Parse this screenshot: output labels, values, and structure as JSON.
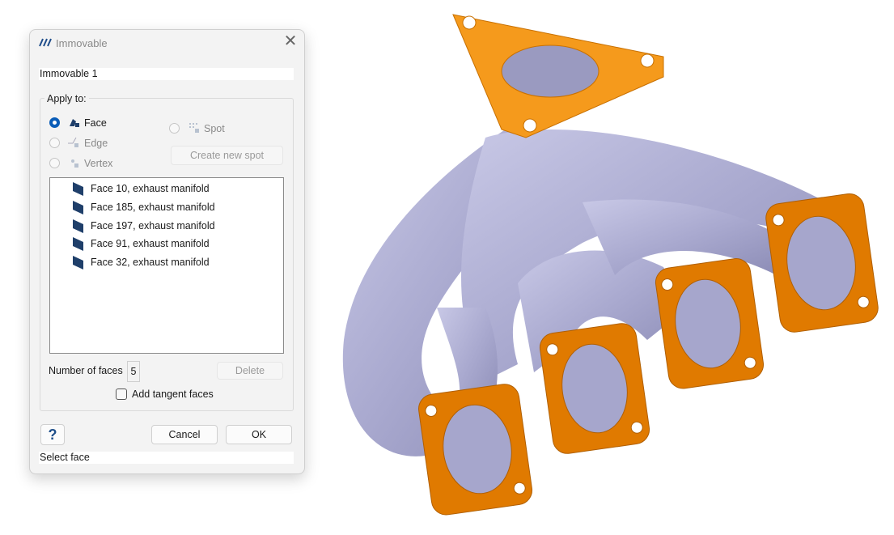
{
  "dialog": {
    "title": "Immovable",
    "name_value": "Immovable 1",
    "group_label": "Apply to:",
    "options": {
      "face": "Face",
      "edge": "Edge",
      "vertex": "Vertex",
      "spot": "Spot"
    },
    "selected_option": "Face",
    "create_spot_label": "Create new spot",
    "faces": [
      "Face 10, exhaust manifold",
      "Face 185, exhaust manifold",
      "Face 197, exhaust manifold",
      "Face 91, exhaust manifold",
      "Face 32, exhaust manifold"
    ],
    "number_of_faces_label": "Number of faces",
    "number_of_faces_value": "5",
    "delete_label": "Delete",
    "add_tangent_label": "Add tangent faces",
    "add_tangent_checked": false,
    "help_label": "?",
    "cancel_label": "Cancel",
    "ok_label": "OK",
    "status": "Select face"
  },
  "colors": {
    "accent": "#0a5db8",
    "model_body": "#aeaed0",
    "model_flange": "#e68a00"
  }
}
